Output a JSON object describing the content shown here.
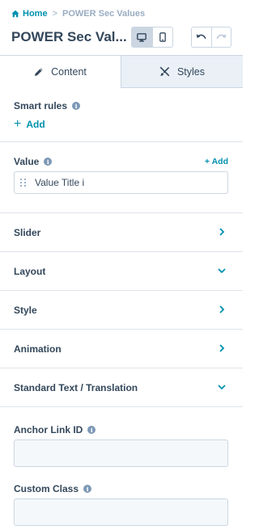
{
  "breadcrumb": {
    "home": "Home",
    "separator": ">",
    "current": "POWER Sec Values"
  },
  "header": {
    "title": "POWER Sec Val..."
  },
  "tabs": [
    {
      "label": "Content",
      "icon": "pencil-icon",
      "active": true
    },
    {
      "label": "Styles",
      "icon": "paint-brush-icon",
      "active": false
    }
  ],
  "smart_rules": {
    "label": "Smart rules",
    "add_label": "Add"
  },
  "value": {
    "label": "Value",
    "add_label": "+ Add",
    "items": [
      "Value Title i"
    ]
  },
  "sections": [
    {
      "label": "Slider",
      "state": "collapsed"
    },
    {
      "label": "Layout",
      "state": "expanded"
    },
    {
      "label": "Style",
      "state": "collapsed"
    },
    {
      "label": "Animation",
      "state": "collapsed"
    },
    {
      "label": "Standard Text / Translation",
      "state": "expanded"
    }
  ],
  "fields": [
    {
      "label": "Anchor Link ID",
      "value": ""
    },
    {
      "label": "Custom Class",
      "value": ""
    }
  ],
  "colors": {
    "accent": "#0091ae",
    "text": "#33475b",
    "border": "#cbd6e2",
    "muted": "#99acc2",
    "tab_inactive_bg": "#eaf0f6"
  }
}
